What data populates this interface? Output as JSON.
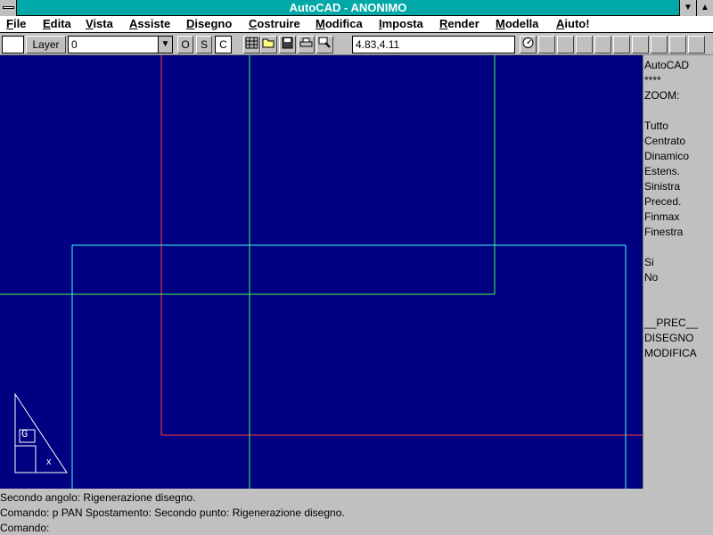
{
  "window": {
    "title": "AutoCAD - ANONIMO",
    "min_glyph": "▼",
    "max_glyph": "▲"
  },
  "menu": [
    "File",
    "Edita",
    "Vista",
    "Assiste",
    "Disegno",
    "Costruire",
    "Modifica",
    "Imposta",
    "Render",
    "Modella",
    "Aiuto!"
  ],
  "toolbar": {
    "layer_button": "Layer",
    "layer_value": "0",
    "ortho": "O",
    "snap": "S",
    "coords_toggle": "C",
    "coordinates": "4.83,4.11"
  },
  "side_menu": {
    "items": [
      "AutoCAD",
      "****",
      "ZOOM:",
      "",
      "Tutto",
      "Centrato",
      "Dinamico",
      "Estens.",
      "Sinistra",
      "Preced.",
      "Finmax",
      "Finestra",
      "",
      "Si",
      "No",
      "",
      "",
      "__PREC__",
      "DISEGNO",
      "MODIFICA"
    ]
  },
  "ucs_icon": {
    "label_g": "G",
    "label_x": "x"
  },
  "command_lines": [
    "Secondo angolo: Rigenerazione disegno.",
    "Comando: p PAN Spostamento:  Secondo punto: Rigenerazione disegno.",
    "Comando:"
  ],
  "colors": {
    "drawing_bg": "#000080",
    "line_red": "#ff4040",
    "line_green": "#40ff40",
    "line_cyan": "#40ffff"
  }
}
